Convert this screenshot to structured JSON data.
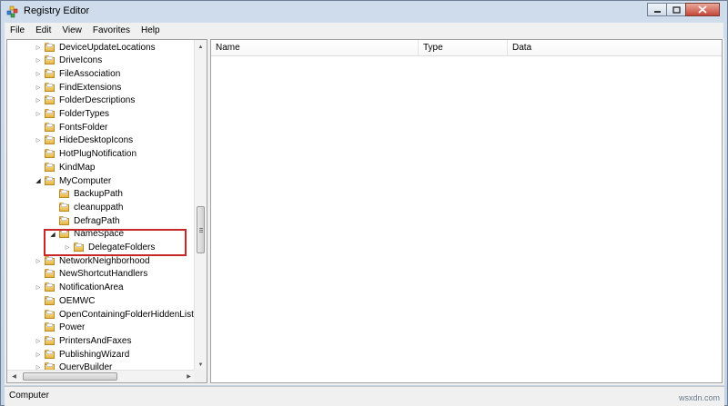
{
  "window": {
    "title": "Registry Editor",
    "minimize_icon": "minimize-icon",
    "maximize_icon": "maximize-icon",
    "close_icon": "close-icon"
  },
  "menu": [
    "File",
    "Edit",
    "View",
    "Favorites",
    "Help"
  ],
  "tree": [
    {
      "label": "DeviceUpdateLocations",
      "expander": "collapsed",
      "level": 0
    },
    {
      "label": "DriveIcons",
      "expander": "collapsed",
      "level": 0
    },
    {
      "label": "FileAssociation",
      "expander": "collapsed",
      "level": 0
    },
    {
      "label": "FindExtensions",
      "expander": "collapsed",
      "level": 0
    },
    {
      "label": "FolderDescriptions",
      "expander": "collapsed",
      "level": 0
    },
    {
      "label": "FolderTypes",
      "expander": "collapsed",
      "level": 0
    },
    {
      "label": "FontsFolder",
      "expander": "none",
      "level": 0
    },
    {
      "label": "HideDesktopIcons",
      "expander": "collapsed",
      "level": 0
    },
    {
      "label": "HotPlugNotification",
      "expander": "none",
      "level": 0
    },
    {
      "label": "KindMap",
      "expander": "none",
      "level": 0
    },
    {
      "label": "MyComputer",
      "expander": "expanded",
      "level": 0
    },
    {
      "label": "BackupPath",
      "expander": "none",
      "level": 1
    },
    {
      "label": "cleanuppath",
      "expander": "none",
      "level": 1
    },
    {
      "label": "DefragPath",
      "expander": "none",
      "level": 1
    },
    {
      "label": "NameSpace",
      "expander": "expanded",
      "level": 1
    },
    {
      "label": "DelegateFolders",
      "expander": "collapsed",
      "level": 2
    },
    {
      "label": "NetworkNeighborhood",
      "expander": "collapsed",
      "level": 0
    },
    {
      "label": "NewShortcutHandlers",
      "expander": "none",
      "level": 0
    },
    {
      "label": "NotificationArea",
      "expander": "collapsed",
      "level": 0
    },
    {
      "label": "OEMWC",
      "expander": "none",
      "level": 0
    },
    {
      "label": "OpenContainingFolderHiddenList",
      "expander": "none",
      "level": 0
    },
    {
      "label": "Power",
      "expander": "none",
      "level": 0
    },
    {
      "label": "PrintersAndFaxes",
      "expander": "collapsed",
      "level": 0
    },
    {
      "label": "PublishingWizard",
      "expander": "collapsed",
      "level": 0
    },
    {
      "label": "QueryBuilder",
      "expander": "collapsed",
      "level": 0
    }
  ],
  "list": {
    "columns": [
      "Name",
      "Type",
      "Data"
    ]
  },
  "status": {
    "path": "Computer"
  },
  "watermark": "wsxdn.com",
  "colors": {
    "highlight": "#c62828",
    "folder": "#e5b646"
  }
}
